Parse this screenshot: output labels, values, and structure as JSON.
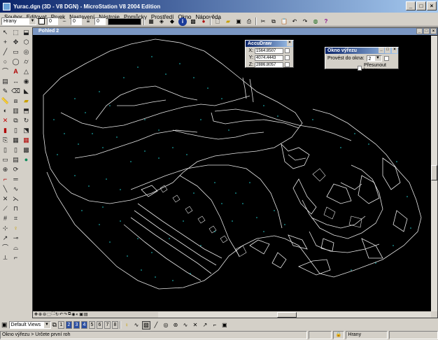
{
  "window": {
    "title": "Yurac.dgn (3D - V8 DGN) - MicroStation V8 2004 Edition",
    "minimize": "_",
    "maximize": "□",
    "close": "×"
  },
  "menu": [
    "Soubor",
    "Editovat",
    "Prvek",
    "Nastavení",
    "Nástroje",
    "Pomůcky",
    "Prostředí",
    "Okno",
    "Nápověda"
  ],
  "toolbar": {
    "level_value": "Hrany",
    "color_value": "0",
    "style_value": "0",
    "weight_value": "0"
  },
  "view": {
    "title": "Pohled 2",
    "min": "_",
    "max": "□",
    "close": "×"
  },
  "accudraw": {
    "title": "AccuDraw",
    "x_label": "X:",
    "x_value": "1564.8507",
    "y_label": "Y:",
    "y_value": "4074.4443",
    "z_label": "Z:",
    "z_value": "2886.8057"
  },
  "clip_dialog": {
    "title": "Okno výřezu",
    "depth_label": "Provést do okna:",
    "depth_value": "2",
    "move_camera_label": "Přesunout kameru"
  },
  "bottom": {
    "views_combo": "Default Views",
    "view_numbers": [
      "1",
      "2",
      "3",
      "4",
      "5",
      "6",
      "7",
      "8"
    ]
  },
  "status": {
    "prompt": "Okno výřezu > Určete první roh",
    "level": "Hrany"
  },
  "colors": {
    "titlebar_start": "#0a246a",
    "titlebar_end": "#a6caf0",
    "view_background": "#000000",
    "line_color": "#ffffff",
    "point_color": "#22cfcf"
  }
}
